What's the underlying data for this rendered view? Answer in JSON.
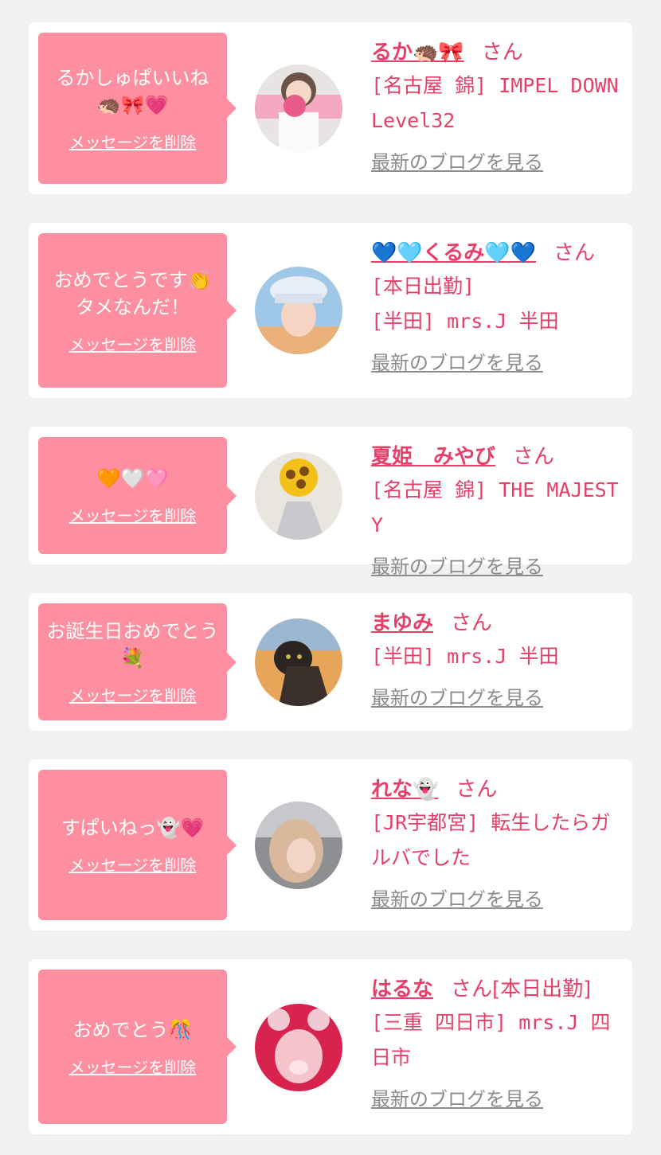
{
  "items": [
    {
      "message": "るかしゅぱいいね🦔🎀💗",
      "delete_label": "メッセージを削除",
      "name": "るか🦔🎀",
      "honorific": "さん",
      "extra": "",
      "lines": [
        "[名古屋 錦] IMPEL DOWN Level32"
      ],
      "blog_label": "最新のブログを見る"
    },
    {
      "message": "おめでとうです👏タメなんだ！",
      "delete_label": "メッセージを削除",
      "name": "💙🩵くるみ🩵💙",
      "honorific": "さん",
      "extra": "",
      "lines": [
        "[本日出勤]",
        "[半田] mrs.J 半田"
      ],
      "blog_label": "最新のブログを見る"
    },
    {
      "message": "🧡🤍🩷",
      "delete_label": "メッセージを削除",
      "name": "夏姫　みやび",
      "honorific": "さん",
      "extra": "",
      "lines": [
        "[名古屋 錦] THE MAJESTY"
      ],
      "blog_label": "最新のブログを見る"
    },
    {
      "message": "お誕生日おめでとう💐",
      "delete_label": "メッセージを削除",
      "name": "まゆみ",
      "honorific": "さん",
      "extra": "",
      "lines": [
        "[半田] mrs.J 半田"
      ],
      "blog_label": "最新のブログを見る"
    },
    {
      "message": "すぱいねっ👻💗",
      "delete_label": "メッセージを削除",
      "name": "れな👻",
      "honorific": "さん",
      "extra": "",
      "lines": [
        "[JR宇都宮] 転生したらガルバでした"
      ],
      "blog_label": "最新のブログを見る"
    },
    {
      "message": "おめでとう🎊",
      "delete_label": "メッセージを削除",
      "name": "はるな",
      "honorific": "さん",
      "extra": "[本日出勤]",
      "lines": [
        "[三重 四日市] mrs.J 四日市"
      ],
      "blog_label": "最新のブログを見る"
    }
  ],
  "colors": {
    "accent": "#e6406a",
    "bubble": "#fe8fa0",
    "link_gray": "#8c8c8c",
    "background": "#f1f1f1"
  }
}
